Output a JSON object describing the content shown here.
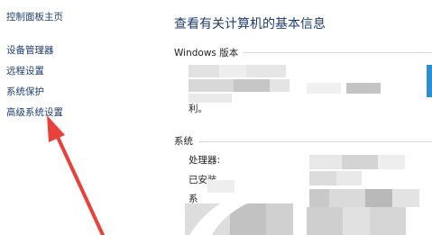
{
  "sidebar": {
    "home": "控制面板主页",
    "items": [
      {
        "label": "设备管理器"
      },
      {
        "label": "远程设置"
      },
      {
        "label": "系统保护"
      },
      {
        "label": "高级系统设置"
      }
    ]
  },
  "main": {
    "title": "查看有关计算机的基本信息",
    "windows_section": {
      "header": "Windows 版本",
      "visible_fragment": "利。"
    },
    "system_section": {
      "header": "系统",
      "processor_label": "处理器:",
      "installed_label": "已安装",
      "third_label_fragment": "系"
    }
  },
  "colors": {
    "link": "#1e3d6e",
    "arrow": "#e8413a",
    "accent_edge": "#2b8fd6"
  },
  "annotation": {
    "icon": "red-arrow-icon"
  }
}
